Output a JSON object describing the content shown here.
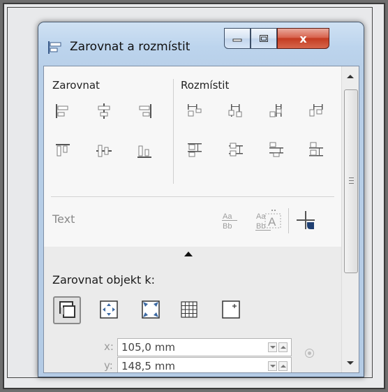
{
  "window": {
    "title": "Zarovnat a rozmístit",
    "close_glyph": "x"
  },
  "align_section": {
    "label": "Zarovnat",
    "tools": [
      "align-left",
      "align-center-horizontal",
      "align-right",
      "align-top",
      "align-center-vertical",
      "align-bottom"
    ]
  },
  "distribute_section": {
    "label": "Rozmístit",
    "tools": [
      "distribute-left",
      "distribute-center-horizontal",
      "distribute-spacing-horizontal",
      "distribute-right",
      "distribute-top",
      "distribute-center-vertical",
      "distribute-spacing-vertical",
      "distribute-bottom"
    ]
  },
  "text_section": {
    "label": "Text",
    "tools": [
      "text-first-line-baseline",
      "text-last-line-baseline",
      "text-bounding-box",
      "snap-outline"
    ]
  },
  "align_to": {
    "label": "Zarovnat objekt k:",
    "targets": [
      "active-objects",
      "page-edge",
      "page-center",
      "grid",
      "specified-point"
    ],
    "x_label": "x:",
    "x_value": "105,0 mm",
    "y_label": "y:",
    "y_value": "148,5 mm"
  },
  "colors": {
    "icon_gray": "#7d7d7d",
    "icon_blue": "#3d6aa3",
    "close_red": "#c43c22"
  }
}
